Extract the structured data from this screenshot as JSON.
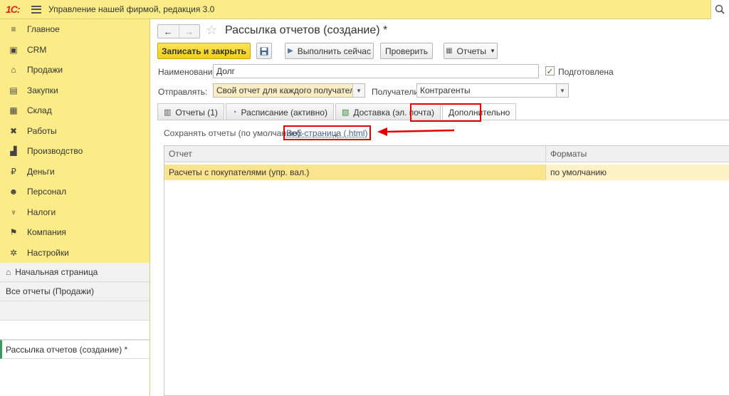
{
  "app": {
    "logo_text": "1С:",
    "title": "Управление нашей фирмой, редакция 3.0"
  },
  "sidebar": {
    "items": [
      {
        "label": "Главное",
        "icon": "list-icon",
        "glyph": "≡"
      },
      {
        "label": "CRM",
        "icon": "contact-card-icon",
        "glyph": "▣"
      },
      {
        "label": "Продажи",
        "icon": "shop-icon",
        "glyph": "⌂"
      },
      {
        "label": "Закупки",
        "icon": "cart-icon",
        "glyph": "▤"
      },
      {
        "label": "Склад",
        "icon": "warehouse-icon",
        "glyph": "▦"
      },
      {
        "label": "Работы",
        "icon": "tools-icon",
        "glyph": "✖"
      },
      {
        "label": "Производство",
        "icon": "factory-icon",
        "glyph": "▟"
      },
      {
        "label": "Деньги",
        "icon": "ruble-icon",
        "glyph": "₽"
      },
      {
        "label": "Персонал",
        "icon": "people-icon",
        "glyph": "☻"
      },
      {
        "label": "Налоги",
        "icon": "emblem-icon",
        "glyph": "♆"
      },
      {
        "label": "Компания",
        "icon": "flag-icon",
        "glyph": "⚑"
      },
      {
        "label": "Настройки",
        "icon": "gear-icon",
        "glyph": "✲"
      }
    ],
    "open_windows": [
      {
        "label": "Начальная страница"
      },
      {
        "label": "Все отчеты (Продажи)"
      },
      {
        "label": ""
      },
      {
        "label": "Рассылка отчетов (создание) *"
      }
    ]
  },
  "header": {
    "title": "Рассылка отчетов (создание) *"
  },
  "toolbar": {
    "save_close": "Записать и закрыть",
    "run_now": "Выполнить сейчас",
    "check": "Проверить",
    "reports": "Отчеты"
  },
  "form": {
    "name_label": "Наименование:",
    "name_value": "Долг",
    "prepared_label": "Подготовлена",
    "prepared_checked": true,
    "send_label": "Отправлять:",
    "send_value": "Свой отчет для каждого получателя",
    "recipients_label": "Получатели:",
    "recipients_value": "Контрагенты"
  },
  "tabs": [
    {
      "label": "Отчеты (1)"
    },
    {
      "label": "Расписание (активно)"
    },
    {
      "label": "Доставка (эл. почта)"
    },
    {
      "label": "Дополнительно"
    }
  ],
  "additional": {
    "save_label": "Сохранять отчеты (по умолчанию):",
    "save_value": "Веб-страница (.html)"
  },
  "table": {
    "columns": [
      "Отчет",
      "Форматы"
    ],
    "rows": [
      {
        "report": "Расчеты с покупателями (упр. вал.)",
        "formats": "по умолчанию"
      }
    ]
  },
  "colors": {
    "accent_yellow": "#fbec88",
    "annotation_red": "#e20000",
    "link_blue": "#3f5f8c"
  }
}
